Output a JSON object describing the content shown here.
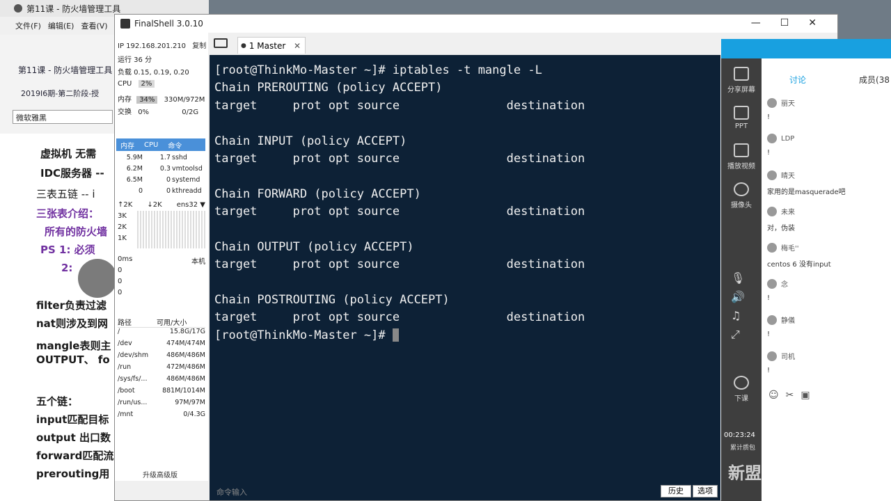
{
  "bgdoc": {
    "title": "第11课 - 防火墙管理工具",
    "menu": [
      "文件(F)",
      "编辑(E)",
      "查看(V)"
    ],
    "lesson_title": "第11课 - 防火墙管理工具",
    "lesson_sub": "2019I6期-第二阶段-授",
    "font": "微软雅黑",
    "lines": [
      "虚拟机  无需",
      "IDC服务器  --",
      "三表五链  -- i",
      "三张表介绍：",
      "所有的防火墙",
      "PS 1: 必须",
      "2: ",
      "filter负责过滤",
      "nat则涉及到网",
      "mangle表则主",
      "OUTPUT、 fo",
      "五个链：",
      "input匹配目标",
      "output  出口数",
      "forward匹配流",
      "prerouting用"
    ]
  },
  "finalshell": {
    "title": "FinalShell 3.0.10",
    "ip": "IP 192.168.201.210",
    "copy": "复制",
    "uptime": "运行 36 分",
    "load": "负载 0.15, 0.19, 0.20",
    "cpu_label": "CPU",
    "cpu_value": "2%",
    "mem_label": "内存",
    "mem_pct": "34%",
    "mem_value": "330M/972M",
    "swap_label": "交换",
    "swap_pct": "0%",
    "swap_value": "0/2G",
    "proc_headers": [
      "内存",
      "CPU",
      "命令"
    ],
    "processes": [
      {
        "mem": "5.9M",
        "cpu": "1.7",
        "cmd": "sshd"
      },
      {
        "mem": "6.2M",
        "cpu": "0.3",
        "cmd": "vmtoolsd"
      },
      {
        "mem": "6.5M",
        "cpu": "0",
        "cmd": "systemd"
      },
      {
        "mem": "0",
        "cpu": "0",
        "cmd": "kthreadd"
      }
    ],
    "net_up": "↑2K",
    "net_down": "↓2K",
    "net_iface": "ens32",
    "net_ticks": [
      "3K",
      "2K",
      "1K"
    ],
    "latency_label": "0ms",
    "latency_host": "本机",
    "latency_vals": [
      "0",
      "0",
      "0"
    ],
    "disk_headers": [
      "路径",
      "可用/大小"
    ],
    "disks": [
      {
        "path": "/",
        "size": "15.8G/17G"
      },
      {
        "path": "/dev",
        "size": "474M/474M"
      },
      {
        "path": "/dev/shm",
        "size": "486M/486M"
      },
      {
        "path": "/run",
        "size": "472M/486M"
      },
      {
        "path": "/sys/fs/...",
        "size": "486M/486M"
      },
      {
        "path": "/boot",
        "size": "881M/1014M"
      },
      {
        "path": "/run/us...",
        "size": "97M/97M"
      },
      {
        "path": "/mnt",
        "size": "0/4.3G"
      }
    ],
    "upgrade": "升级高级版",
    "tab_label": "1 Master",
    "cmd_hint": "命令输入",
    "history_btn": "历史",
    "options_btn": "选项"
  },
  "terminal": {
    "lines": [
      "[root@ThinkMo-Master ~]# iptables -t mangle -L",
      "Chain PREROUTING (policy ACCEPT)",
      "target     prot opt source               destination",
      "",
      "Chain INPUT (policy ACCEPT)",
      "target     prot opt source               destination",
      "",
      "Chain FORWARD (policy ACCEPT)",
      "target     prot opt source               destination",
      "",
      "Chain OUTPUT (policy ACCEPT)",
      "target     prot opt source               destination",
      "",
      "Chain POSTROUTING (policy ACCEPT)",
      "target     prot opt source               destination",
      "[root@ThinkMo-Master ~]# "
    ]
  },
  "stream": {
    "tools": [
      "分享屏幕",
      "PPT",
      "播放视频",
      "摄像头",
      "下课"
    ],
    "time": "00:23:24",
    "stat": "累计质包",
    "chat_tabs": [
      "讨论",
      "成员(38"
    ],
    "messages": [
      {
        "who": "丽天",
        "text": "!"
      },
      {
        "who": "LDP",
        "text": "!"
      },
      {
        "who": "晴天",
        "text": "家用的是masquerade吧"
      },
      {
        "who": "未来",
        "text": "对，伪装"
      },
      {
        "who": "梅毛''",
        "text": "centos 6 没有input"
      },
      {
        "who": "念",
        "text": "!"
      },
      {
        "who": "静儀",
        "text": "!"
      },
      {
        "who": "司机",
        "text": "!"
      }
    ],
    "watermark": "新盟"
  }
}
